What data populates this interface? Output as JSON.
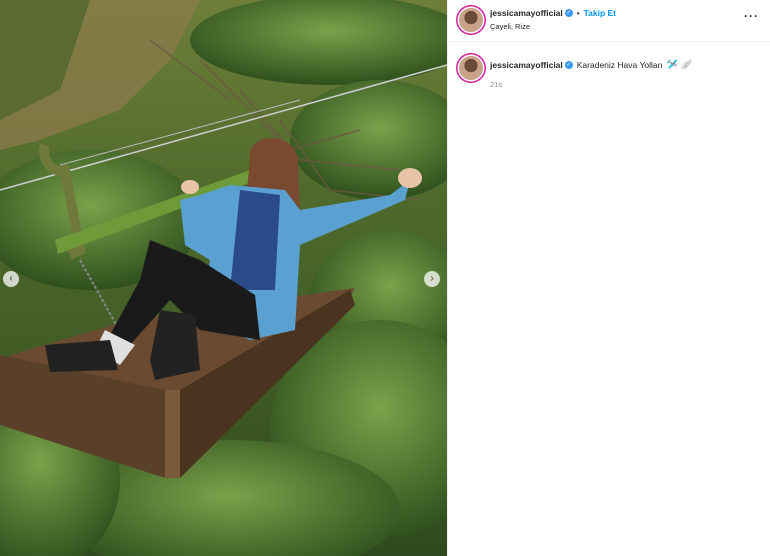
{
  "post": {
    "image_alt": "Woman sitting on a cable-car platform above tea plantation",
    "nav": {
      "prev_icon": "chevron-left-icon",
      "next_icon": "chevron-right-icon",
      "prev_glyph": "‹",
      "next_glyph": "›"
    }
  },
  "header": {
    "username": "jessicamayofficial",
    "verified_glyph": "✓",
    "separator": "•",
    "follow_label": "Takip Et",
    "location": "Çayeli, Rize",
    "more_glyph": "···"
  },
  "caption": {
    "username": "jessicamayofficial",
    "verified_glyph": "✓",
    "text": "Karadeniz Hava Yolları",
    "emojis": "🛩️ 🪽",
    "time": "21s"
  },
  "colors": {
    "accent": "#0095f6",
    "verified": "#3897f0",
    "muted": "#8e8e8e"
  }
}
